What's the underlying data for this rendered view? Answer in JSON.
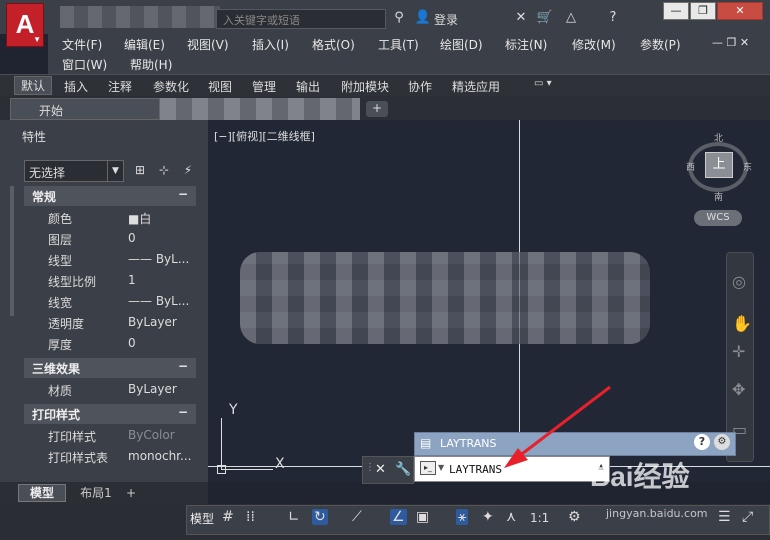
{
  "app": {
    "logo": "A",
    "search_placeholder": "入关键字或短语",
    "login": "登录"
  },
  "menu": {
    "row1": [
      "文件(F)",
      "编辑(E)",
      "视图(V)",
      "插入(I)",
      "格式(O)",
      "工具(T)",
      "绘图(D)",
      "标注(N)",
      "修改(M)",
      "参数(P)"
    ],
    "row2": [
      "窗口(W)",
      "帮助(H)"
    ]
  },
  "ribbon_tabs": [
    "默认",
    "插入",
    "注释",
    "参数化",
    "视图",
    "管理",
    "输出",
    "附加模块",
    "协作",
    "精选应用"
  ],
  "doc_tabs": {
    "start": "开始",
    "add": "+"
  },
  "properties": {
    "title": "特性",
    "selection": "无选择",
    "sections": [
      {
        "name": "常规",
        "collapse": "−",
        "rows": [
          {
            "key": "颜色",
            "value": "■白"
          },
          {
            "key": "图层",
            "value": "0"
          },
          {
            "key": "线型",
            "value": "—— ByL..."
          },
          {
            "key": "线型比例",
            "value": "1"
          },
          {
            "key": "线宽",
            "value": "—— ByL..."
          },
          {
            "key": "透明度",
            "value": "ByLayer"
          },
          {
            "key": "厚度",
            "value": "0"
          }
        ]
      },
      {
        "name": "三维效果",
        "collapse": "−",
        "rows": [
          {
            "key": "材质",
            "value": "ByLayer"
          }
        ]
      },
      {
        "name": "打印样式",
        "collapse": "−",
        "rows": [
          {
            "key": "打印样式",
            "value": "ByColor"
          },
          {
            "key": "打印样式表",
            "value": "monochr..."
          }
        ]
      }
    ]
  },
  "viewport": {
    "label": "[−][俯视][二维线框]"
  },
  "viewcube": {
    "face": "上",
    "north": "北",
    "south": "南",
    "east": "东",
    "west": "西",
    "wcs": "WCS"
  },
  "ucs": {
    "x": "X",
    "y": "Y"
  },
  "layout_tabs": {
    "model": "模型",
    "layout1": "布局1",
    "add": "+"
  },
  "statusbar": {
    "model": "模型",
    "scale": "1:1"
  },
  "command": {
    "title": "LAYTRANS",
    "input": "LAYTRANS"
  },
  "watermark": {
    "text": "Bai经验",
    "sub": "jingyan.baidu.com"
  }
}
